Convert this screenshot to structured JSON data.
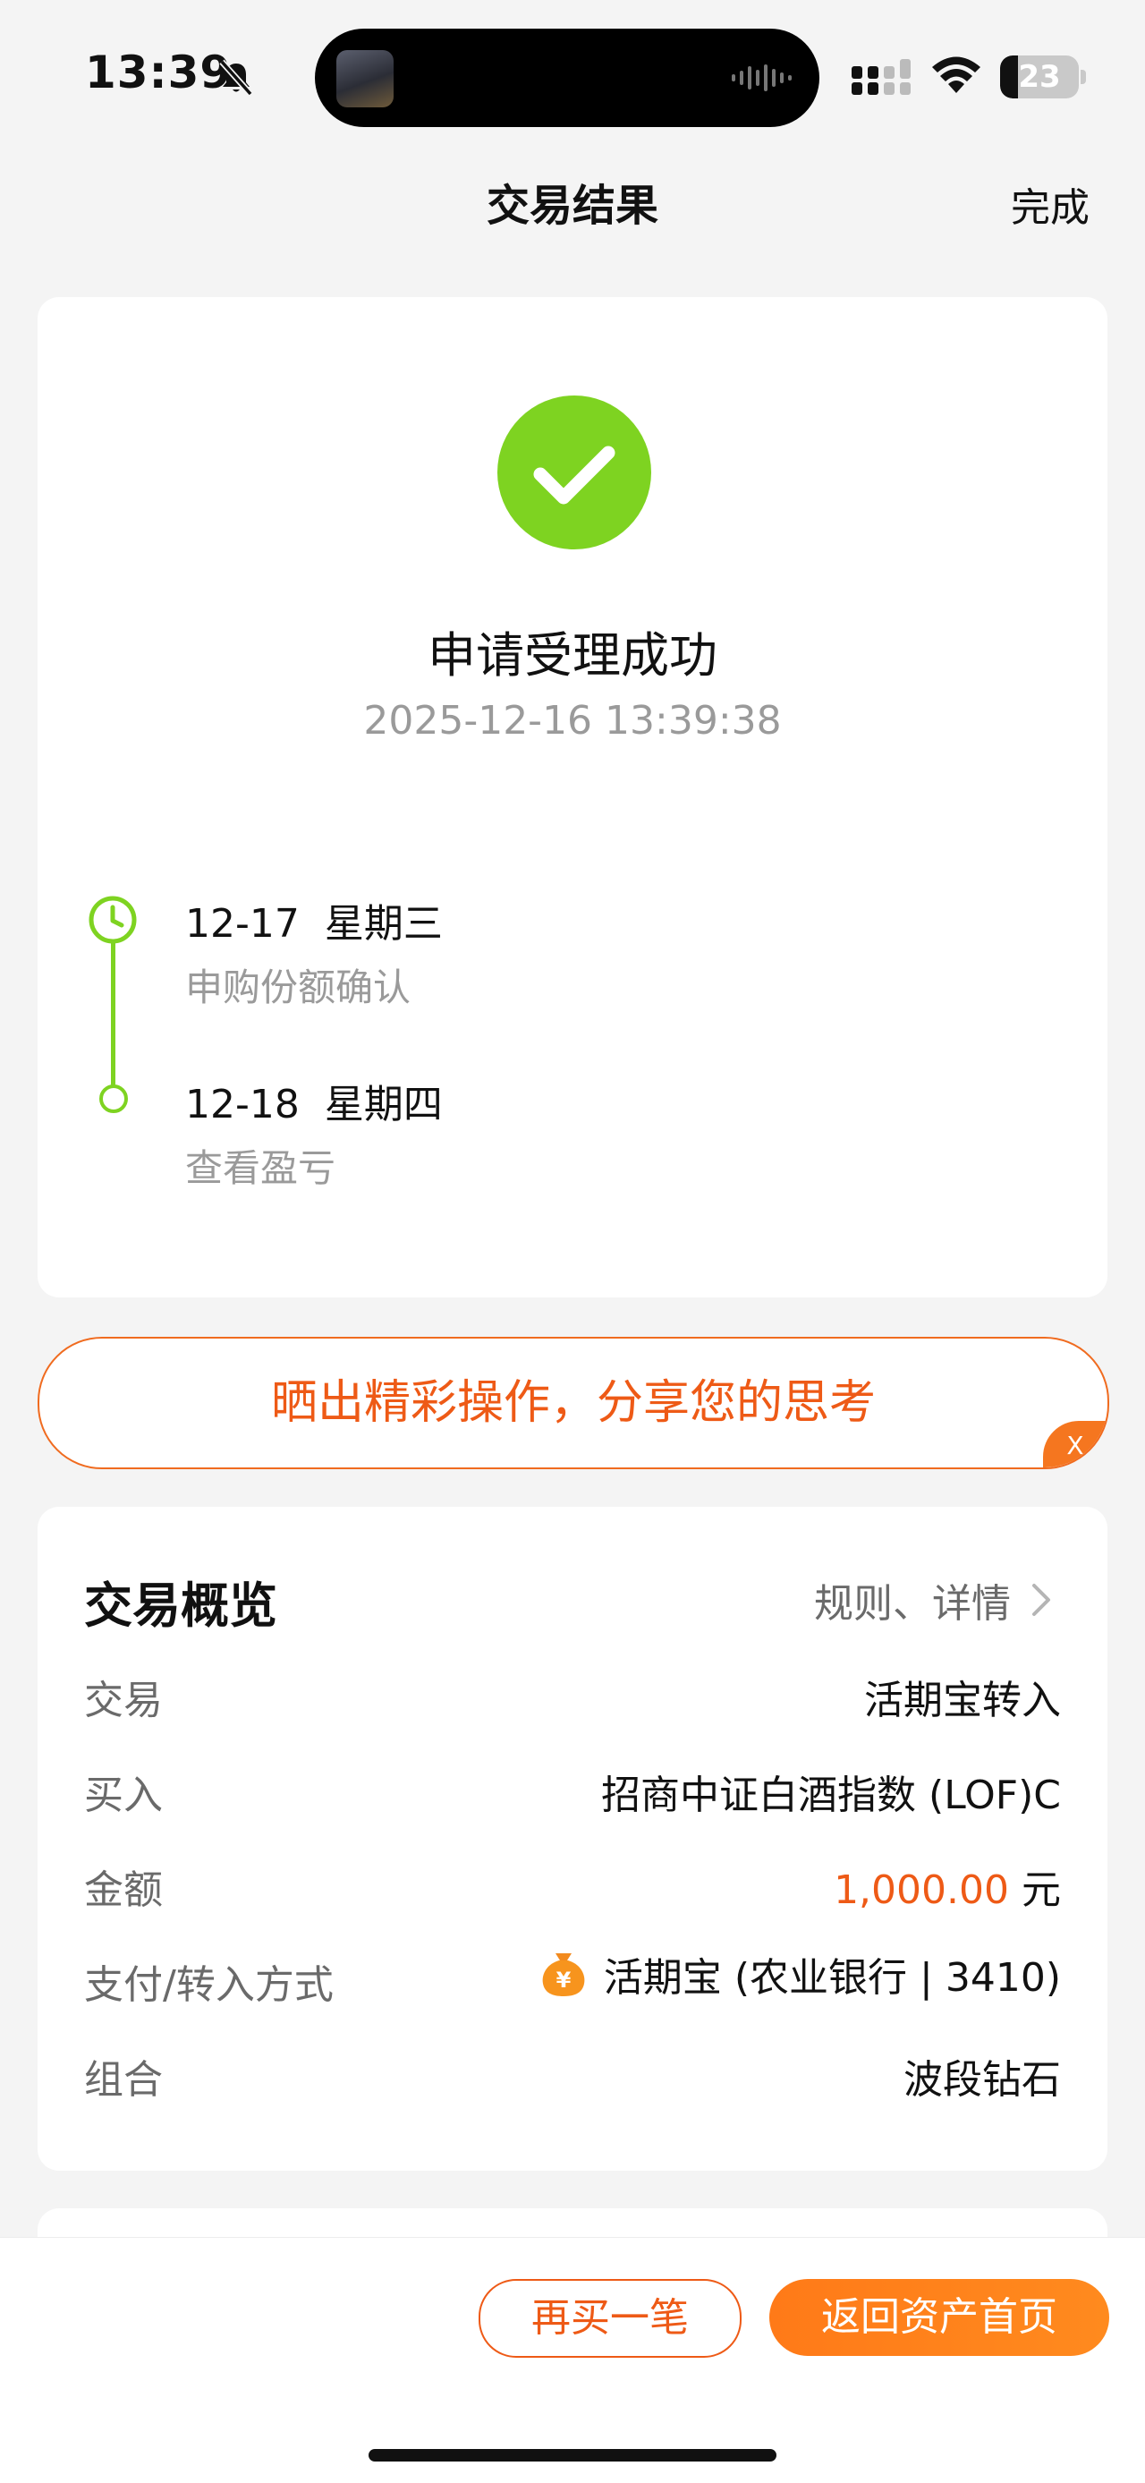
{
  "status_bar": {
    "time": "13:39",
    "battery": "23",
    "battery_level": 0.23,
    "icons": [
      "bell-muted-icon",
      "signal-icon",
      "wifi-icon",
      "battery-icon"
    ]
  },
  "nav": {
    "title": "交易结果",
    "done": "完成"
  },
  "result": {
    "title": "申请受理成功",
    "time": "2025-12-16 13:39:38",
    "steps": [
      {
        "date": "12-17  星期三",
        "desc": "申购份额确认"
      },
      {
        "date": "12-18  星期四",
        "desc": "查看盈亏"
      }
    ]
  },
  "share_banner": {
    "text": "晒出精彩操作，分享您的思考",
    "close": "X"
  },
  "overview": {
    "title": "交易概览",
    "link": "规则、详情",
    "rows": [
      {
        "label": "交易",
        "value": "活期宝转入"
      },
      {
        "label": "买入",
        "value": "招商中证白酒指数 (LOF)C"
      },
      {
        "label": "金额",
        "amount": "1,000.00",
        "unit": " 元"
      },
      {
        "label": "支付/转入方式",
        "value": "活期宝 (农业银行 | 3410)"
      },
      {
        "label": "组合",
        "value": "波段钻石"
      }
    ]
  },
  "actions": {
    "rebuy": "再买一笔",
    "home": "返回资产首页"
  },
  "colors": {
    "accent": "#ee5a16",
    "success": "#7ed321",
    "muted": "#9a9a9a"
  }
}
